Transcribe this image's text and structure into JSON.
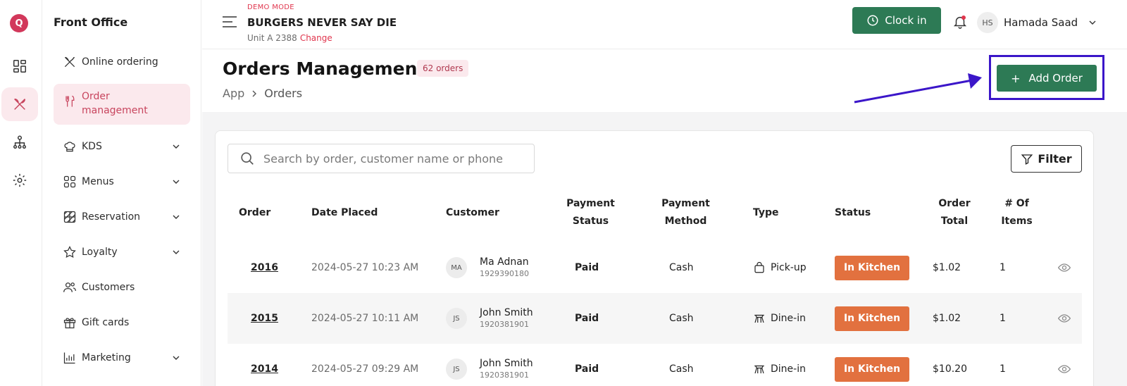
{
  "rail": {
    "logo": "Q",
    "items": [
      {
        "icon": "dashboard-icon"
      },
      {
        "icon": "utensils-icon",
        "active": true
      },
      {
        "icon": "org-chart-icon"
      },
      {
        "icon": "settings-gear-icon"
      }
    ]
  },
  "sidebar": {
    "title": "Front Office",
    "items": [
      {
        "label": "Online ordering",
        "icon": "utensils-crossed-icon",
        "expandable": false
      },
      {
        "label": "Order management",
        "icon": "fork-knife-icon",
        "expandable": false,
        "active": true
      },
      {
        "label": "KDS",
        "icon": "chef-hat-icon",
        "expandable": true
      },
      {
        "label": "Menus",
        "icon": "grid-icon",
        "expandable": true
      },
      {
        "label": "Reservation",
        "icon": "calendar-grid-icon",
        "expandable": true
      },
      {
        "label": "Loyalty",
        "icon": "star-icon",
        "expandable": true
      },
      {
        "label": "Customers",
        "icon": "users-icon",
        "expandable": false
      },
      {
        "label": "Gift cards",
        "icon": "gift-icon",
        "expandable": false
      },
      {
        "label": "Marketing",
        "icon": "bar-chart-icon",
        "expandable": true
      }
    ]
  },
  "header": {
    "demo_mode": "DEMO MODE",
    "restaurant": "BURGERS NEVER SAY DIE",
    "unit": "Unit A 2388",
    "change_link": "Change",
    "clock_in": "Clock in",
    "user_initials": "HS",
    "user_name": "Hamada Saad"
  },
  "page": {
    "title": "Orders Management",
    "count_badge": "62 orders",
    "breadcrumb": [
      "App",
      "Orders"
    ],
    "add_order": "Add Order",
    "add_icon": "+"
  },
  "toolbar": {
    "search_placeholder": "Search by order, customer name or phone",
    "filter_label": "Filter"
  },
  "table": {
    "headers": {
      "order": "Order",
      "date": "Date Placed",
      "customer": "Customer",
      "payment_status_1": "Payment",
      "payment_status_2": "Status",
      "payment_method_1": "Payment",
      "payment_method_2": "Method",
      "type": "Type",
      "status": "Status",
      "order_total_1": "Order",
      "order_total_2": "Total",
      "items_1": "# Of",
      "items_2": "Items"
    },
    "rows": [
      {
        "order": "2016",
        "date": "2024-05-27 10:23 AM",
        "initials": "MA",
        "name": "Ma Adnan",
        "phone": "1929390180",
        "payment_status": "Paid",
        "payment_method": "Cash",
        "type": "Pick-up",
        "type_icon": "bag-icon",
        "status": "In Kitchen",
        "total": "$1.02",
        "items": "1"
      },
      {
        "order": "2015",
        "date": "2024-05-27 10:11 AM",
        "initials": "JS",
        "name": "John Smith",
        "phone": "1920381901",
        "payment_status": "Paid",
        "payment_method": "Cash",
        "type": "Dine-in",
        "type_icon": "table-icon",
        "status": "In Kitchen",
        "total": "$1.02",
        "items": "1"
      },
      {
        "order": "2014",
        "date": "2024-05-27 09:29 AM",
        "initials": "JS",
        "name": "John Smith",
        "phone": "1920381901",
        "payment_status": "Paid",
        "payment_method": "Cash",
        "type": "Dine-in",
        "type_icon": "table-icon",
        "status": "In Kitchen",
        "total": "$10.20",
        "items": "1"
      }
    ]
  },
  "colors": {
    "brand_green": "#2d7a55",
    "accent_pink": "#e0354d",
    "status_orange": "#e2713f",
    "annotation_blue": "#3b16c9"
  }
}
